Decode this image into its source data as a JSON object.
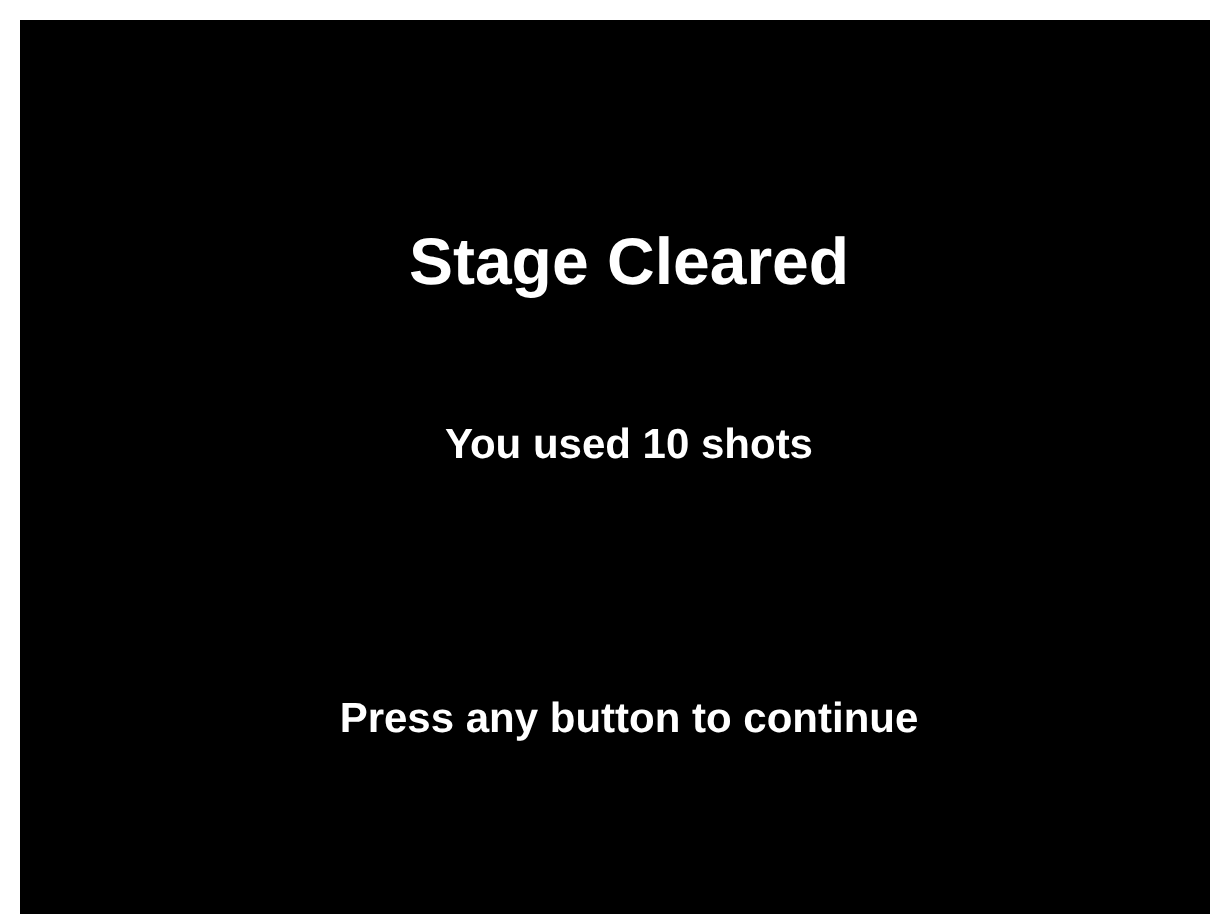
{
  "title": "Stage Cleared",
  "message": "You used 10 shots",
  "prompt": "Press any button to continue"
}
